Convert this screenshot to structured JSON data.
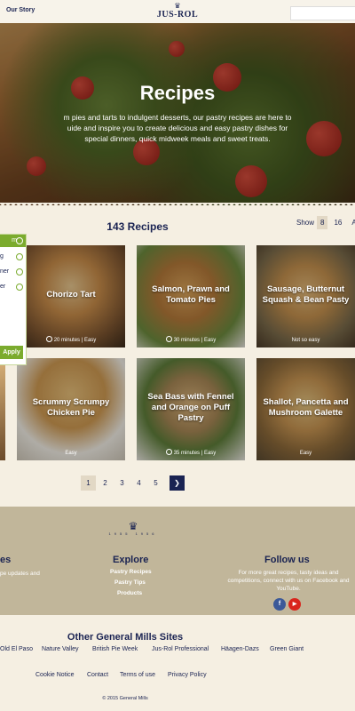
{
  "header": {
    "nav_our_story": "Our Story",
    "logo_text": "JUS-ROL",
    "search_placeholder": ""
  },
  "hero": {
    "title": "Recipes",
    "description_line1": "m pies and tarts to indulgent desserts, our pastry recipes are here to",
    "description_line2": "uide and inspire you to create delicious and easy pastry dishes for",
    "description_line3": "special dinners, quick midweek meals and sweet treats."
  },
  "listing": {
    "count_title": "143 Recipes",
    "show_label": "Show",
    "show_options": [
      "8",
      "16",
      "A"
    ],
    "show_selected": "8"
  },
  "filter": {
    "items": [
      "m",
      "g",
      "ner",
      "er"
    ],
    "apply_label": "Apply"
  },
  "recipes": [
    {
      "title": "Chorizo Tart",
      "meta": "20 minutes | Easy",
      "has_time": true
    },
    {
      "title": "Salmon, Prawn and Tomato Pies",
      "meta": "30 minutes | Easy",
      "has_time": true
    },
    {
      "title": "Sausage, Butternut Squash & Bean Pasty",
      "meta": "Not so easy",
      "has_time": false
    },
    {
      "title": "Scrummy Scrumpy Chicken Pie",
      "meta": "Easy",
      "has_time": false
    },
    {
      "title": "Sea Bass with Fennel and Orange on Puff Pastry",
      "meta": "35 minutes | Easy",
      "has_time": true
    },
    {
      "title": "Shallot, Pancetta and Mushroom Galette",
      "meta": "Easy",
      "has_time": false
    }
  ],
  "pagination": {
    "pages": [
      "1",
      "2",
      "3",
      "4",
      "5"
    ],
    "current": "1",
    "next_icon": "chevron-right-icon"
  },
  "footer": {
    "badge_years_left": "1955",
    "badge_years_right": "1956",
    "left_heading": "es",
    "left_text": "pe updates and",
    "explore_heading": "Explore",
    "explore_links": [
      "Pastry Recipes",
      "Pastry Tips",
      "Products"
    ],
    "follow_heading": "Follow us",
    "follow_text_line1": "For more great recipes, tasty ideas and",
    "follow_text_line2": "competitions, connect with us on Facebook and",
    "follow_text_line3": "YouTube.",
    "social": [
      {
        "icon": "facebook-icon",
        "glyph": "f",
        "color": "#3b5998"
      },
      {
        "icon": "youtube-icon",
        "glyph": "▶",
        "color": "#d9251c"
      }
    ]
  },
  "other_sites": {
    "title": "Other General Mills Sites",
    "sites": [
      "Old El Paso",
      "Nature Valley",
      "British Pie Week",
      "Jus-Rol Professional",
      "Häagen-Dazs",
      "Green Giant"
    ]
  },
  "legal": {
    "links": [
      "Cookie Notice",
      "Contact",
      "Terms of use",
      "Privacy Policy"
    ],
    "copyright": "© 2015 General Mills"
  },
  "colors": {
    "navy": "#1a2352",
    "green": "#7bab2e",
    "cream": "#f5efe2",
    "footer_tan": "#c1b69a"
  }
}
